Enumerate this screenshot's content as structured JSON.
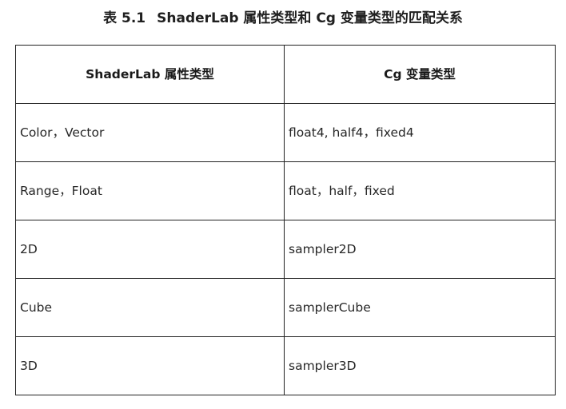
{
  "caption": {
    "number": "表 5.1",
    "title": "ShaderLab 属性类型和 Cg 变量类型的匹配关系"
  },
  "table": {
    "headers": [
      "ShaderLab 属性类型",
      "Cg 变量类型"
    ],
    "rows": [
      [
        "Color，Vector",
        "float4, half4，fixed4"
      ],
      [
        "Range，Float",
        "float，half，fixed"
      ],
      [
        "2D",
        "sampler2D"
      ],
      [
        "Cube",
        "samplerCube"
      ],
      [
        "3D",
        "sampler3D"
      ]
    ]
  }
}
